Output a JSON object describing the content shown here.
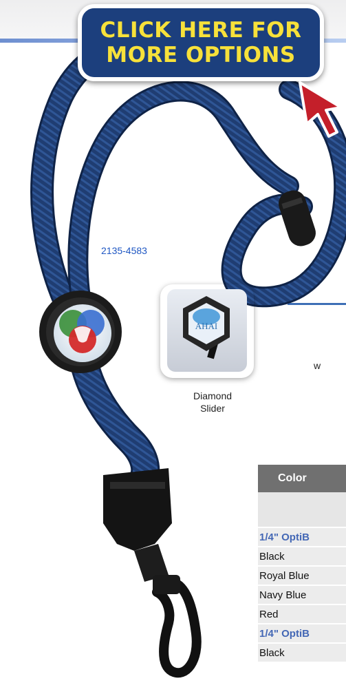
{
  "cta": {
    "line1": "CLICK HERE FOR",
    "line2": "MORE OPTIONS"
  },
  "part_number": "2135-4583",
  "slider": {
    "caption_line1": "Diamond",
    "caption_line2": "Slider",
    "logo_text": "AHAI"
  },
  "side_letter": "w",
  "table": {
    "header": "Color",
    "rows": [
      {
        "text": "1/4\" OptiB",
        "type": "section"
      },
      {
        "text": "Black",
        "type": "item"
      },
      {
        "text": "Royal Blue",
        "type": "item"
      },
      {
        "text": "Navy Blue",
        "type": "item"
      },
      {
        "text": "Red",
        "type": "item"
      },
      {
        "text": "1/4\" OptiB",
        "type": "section"
      },
      {
        "text": "Black",
        "type": "item"
      }
    ]
  },
  "colors": {
    "cta_bg": "#1c3f7d",
    "cta_text": "#f7e13a",
    "cord": "#1e3a6b",
    "accent_line": "#3e6fb6"
  },
  "icons": [
    "cursor-arrow-icon",
    "logo-medallion-icon"
  ]
}
